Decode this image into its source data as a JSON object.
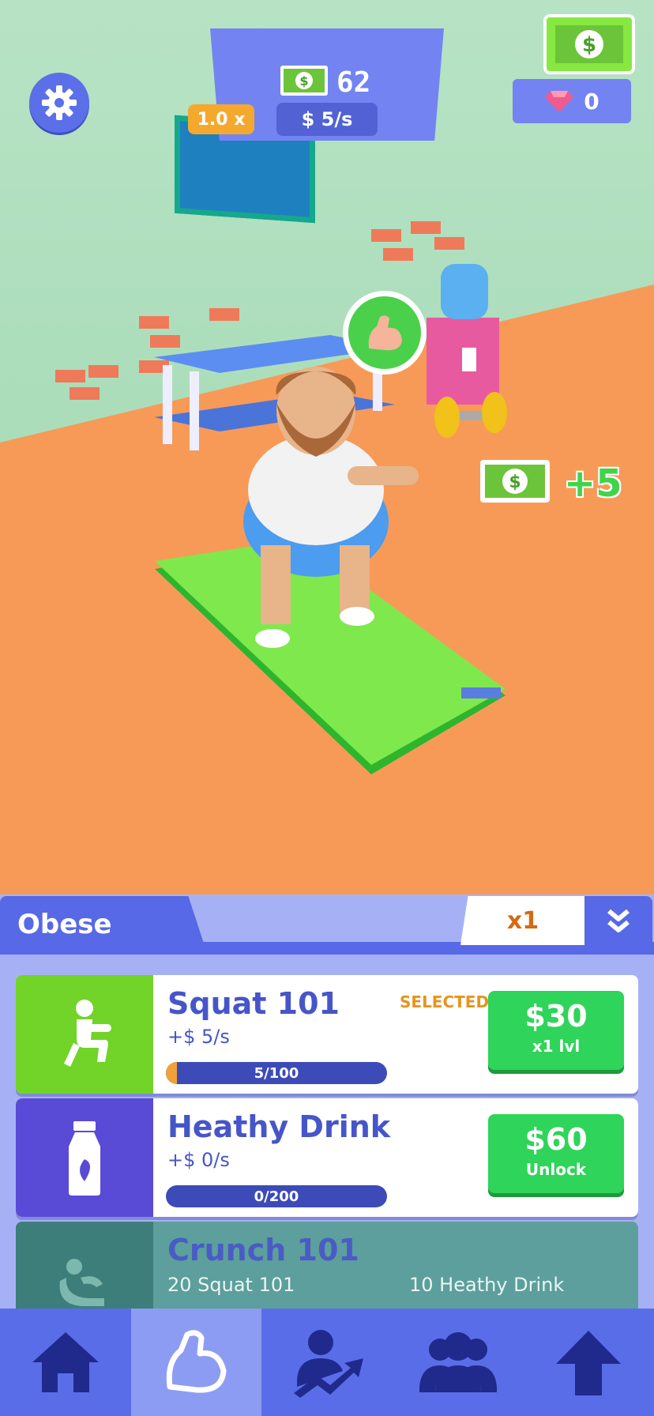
{
  "hud": {
    "cash": "62",
    "multiplier": "1.0 x",
    "rate": "$ 5/s",
    "gems": "0",
    "floating_reward": "+5"
  },
  "icons": {
    "settings": "gear-icon",
    "cash": "dollar-bill-icon",
    "gem": "gem-icon",
    "flex": "flexed-arm-icon"
  },
  "panel": {
    "category": "Obese",
    "buy_multiplier": "x1"
  },
  "workouts": [
    {
      "title": "Squat 101",
      "rate": "+$ 5/s",
      "progress_text": "5/100",
      "progress": 0.05,
      "status": "SELECTED",
      "price": "$30",
      "action": "x1 lvl",
      "icon": "squat-icon",
      "thumb_color": "#72d328"
    },
    {
      "title": "Heathy Drink",
      "rate": "+$ 0/s",
      "progress_text": "0/200",
      "progress": 0,
      "price": "$60",
      "action": "Unlock",
      "icon": "milk-bottle-icon",
      "thumb_color": "#5a4bd6"
    },
    {
      "title": "Crunch 101",
      "requirement_1": "20 Squat 101",
      "requirement_2": "10 Heathy Drink",
      "icon": "crunch-icon"
    }
  ],
  "nav": [
    {
      "icon": "home-icon"
    },
    {
      "icon": "flexed-arm-icon",
      "active": true
    },
    {
      "icon": "user-growth-icon"
    },
    {
      "icon": "group-icon"
    },
    {
      "icon": "arrow-up-icon"
    }
  ],
  "colors": {
    "accent": "#5a6de8",
    "buy_green": "#2fd45a",
    "wall": "#b7e3c4",
    "floor": "#f79a58"
  }
}
